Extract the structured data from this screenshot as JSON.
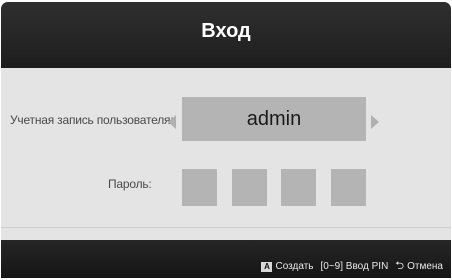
{
  "dialog": {
    "title": "Вход",
    "account_label": "Учетная запись пользователя:",
    "account_value": "admin",
    "password_label": "Пароль:",
    "pin_boxes": [
      "",
      "",
      "",
      ""
    ]
  },
  "footer": {
    "create_key": "A",
    "create_label": "Создать",
    "pin_hint": "[0~9] Ввод PIN",
    "cancel_label": "Отмена"
  },
  "colors": {
    "header_bg": "#262626",
    "body_bg": "#e4e4e4",
    "field_bg": "#b4b4b4",
    "footer_bg": "#1c1c1c"
  },
  "icons": {
    "left": "triangle-left-icon",
    "right": "triangle-right-icon",
    "return": "return-icon"
  }
}
